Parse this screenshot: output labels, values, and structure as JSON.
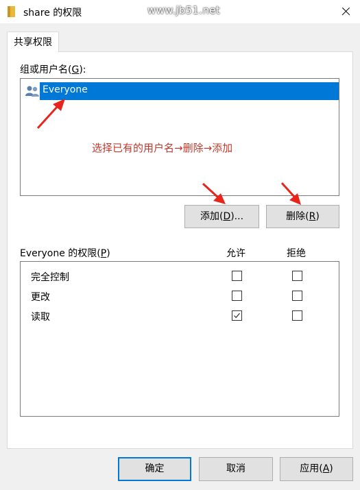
{
  "window": {
    "title": "share 的权限",
    "watermark": "www.jb51.net"
  },
  "tab": {
    "label": "共享权限"
  },
  "group_section": {
    "label_pre": "组或用户名(",
    "label_key": "G",
    "label_post": "):",
    "users": [
      {
        "name": "Everyone",
        "selected": true
      }
    ]
  },
  "annotation": {
    "text": "选择已有的用户名→删除→添加"
  },
  "buttons": {
    "add": {
      "pre": "添加(",
      "key": "D",
      "post": ")..."
    },
    "remove": {
      "pre": "删除(",
      "key": "R",
      "post": ")"
    },
    "ok": {
      "label": "确定"
    },
    "cancel": {
      "label": "取消"
    },
    "apply": {
      "pre": "应用(",
      "key": "A",
      "post": ")"
    }
  },
  "permissions": {
    "label_pre": "Everyone 的权限(",
    "label_key": "P",
    "label_post": ")",
    "allow_header": "允许",
    "deny_header": "拒绝",
    "rows": [
      {
        "name": "完全控制",
        "allow": false,
        "deny": false
      },
      {
        "name": "更改",
        "allow": false,
        "deny": false
      },
      {
        "name": "读取",
        "allow": true,
        "deny": false
      }
    ]
  },
  "colors": {
    "selection": "#0078d7",
    "annotation": "#c0392b",
    "arrow": "#e8251c"
  }
}
